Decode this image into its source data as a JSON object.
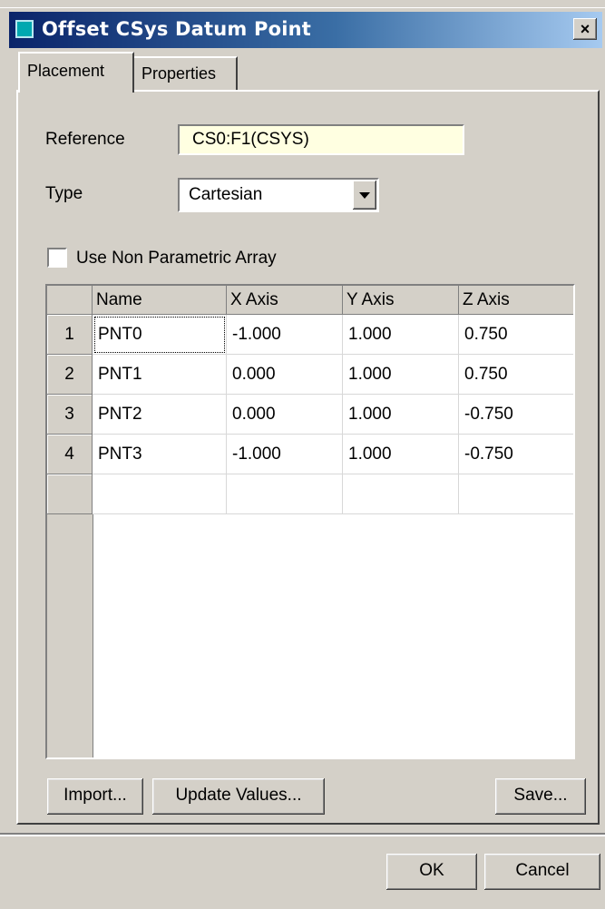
{
  "window": {
    "title": "Offset CSys Datum Point",
    "close_label": "×"
  },
  "tabs": [
    "Placement",
    "Properties"
  ],
  "reference": {
    "label": "Reference",
    "value": "CS0:F1(CSYS)"
  },
  "type": {
    "label": "Type",
    "value": "Cartesian"
  },
  "non_parametric": {
    "label": "Use Non Parametric Array",
    "checked": false
  },
  "table": {
    "columns": [
      "Name",
      "X Axis",
      "Y Axis",
      "Z Axis"
    ],
    "rows": [
      {
        "num": "1",
        "name": "PNT0",
        "x": "-1.000",
        "y": "1.000",
        "z": "0.750"
      },
      {
        "num": "2",
        "name": "PNT1",
        "x": "0.000",
        "y": "1.000",
        "z": "0.750"
      },
      {
        "num": "3",
        "name": "PNT2",
        "x": "0.000",
        "y": "1.000",
        "z": "-0.750"
      },
      {
        "num": "4",
        "name": "PNT3",
        "x": "-1.000",
        "y": "1.000",
        "z": "-0.750"
      }
    ]
  },
  "buttons": {
    "import": "Import...",
    "update": "Update Values...",
    "save": "Save...",
    "ok": "OK",
    "cancel": "Cancel"
  }
}
